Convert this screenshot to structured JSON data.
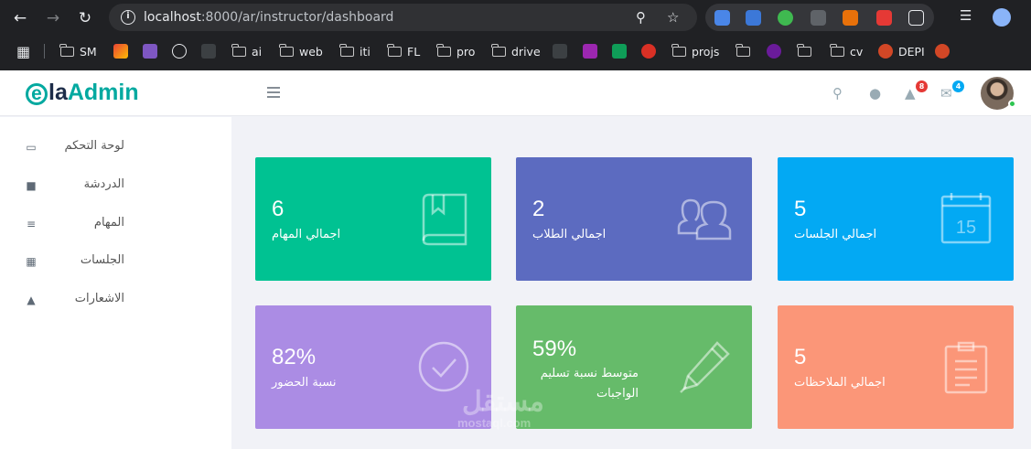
{
  "browser": {
    "url_host": "localhost",
    "url_path": ":8000/ar/instructor/dashboard",
    "bookmarks": [
      {
        "label": "SM",
        "type": "folder"
      },
      {
        "label": "",
        "type": "gmail"
      },
      {
        "label": "",
        "type": "mail"
      },
      {
        "label": "",
        "type": "vercel"
      },
      {
        "label": "",
        "type": "misc"
      },
      {
        "label": "ai",
        "type": "folder"
      },
      {
        "label": "web",
        "type": "folder"
      },
      {
        "label": "iti",
        "type": "folder"
      },
      {
        "label": "FL",
        "type": "folder"
      },
      {
        "label": "pro",
        "type": "folder"
      },
      {
        "label": "drive",
        "type": "folder"
      },
      {
        "label": "projs",
        "type": "folder"
      },
      {
        "label": "cv",
        "type": "folder"
      },
      {
        "label": "DEPI",
        "type": "pdf"
      }
    ]
  },
  "app": {
    "logo_e": "e",
    "logo_la": "la",
    "logo_admin": "Admin",
    "notifications_count": "8",
    "messages_count": "4"
  },
  "sidebar": {
    "items": [
      {
        "label": "لوحة التحكم",
        "icon": "laptop-icon"
      },
      {
        "label": "الدردشة",
        "icon": "comments-icon"
      },
      {
        "label": "المهام",
        "icon": "list-icon"
      },
      {
        "label": "الجلسات",
        "icon": "calendar-icon"
      },
      {
        "label": "الاشعارات",
        "icon": "bell-icon"
      }
    ]
  },
  "cards": [
    {
      "value": "6",
      "label": "اجمالي المهام",
      "color": "#00c292",
      "icon": "book-icon"
    },
    {
      "value": "2",
      "label": "اجمالي الطلاب",
      "color": "#5c6bc0",
      "icon": "users-icon"
    },
    {
      "value": "5",
      "label": "اجمالي الجلسات",
      "color": "#03a9f3",
      "icon": "calendar-15-icon",
      "icon_text": "15"
    },
    {
      "value": "82%",
      "label": "نسبة الحضور",
      "color": "#ab8ce4",
      "icon": "check-circle-icon"
    },
    {
      "value": "59%",
      "label": "متوسط نسبة تسليم الواجبات",
      "label_line1": "متوسط نسبة تسليم",
      "label_line2": "الواجبات",
      "color": "#66bb6a",
      "icon": "pen-icon"
    },
    {
      "value": "5",
      "label": "اجمالي الملاحظات",
      "color": "#fb9678",
      "icon": "clipboard-icon"
    }
  ],
  "watermark": {
    "arabic": "مستقل",
    "latin": "mostaql.com"
  }
}
